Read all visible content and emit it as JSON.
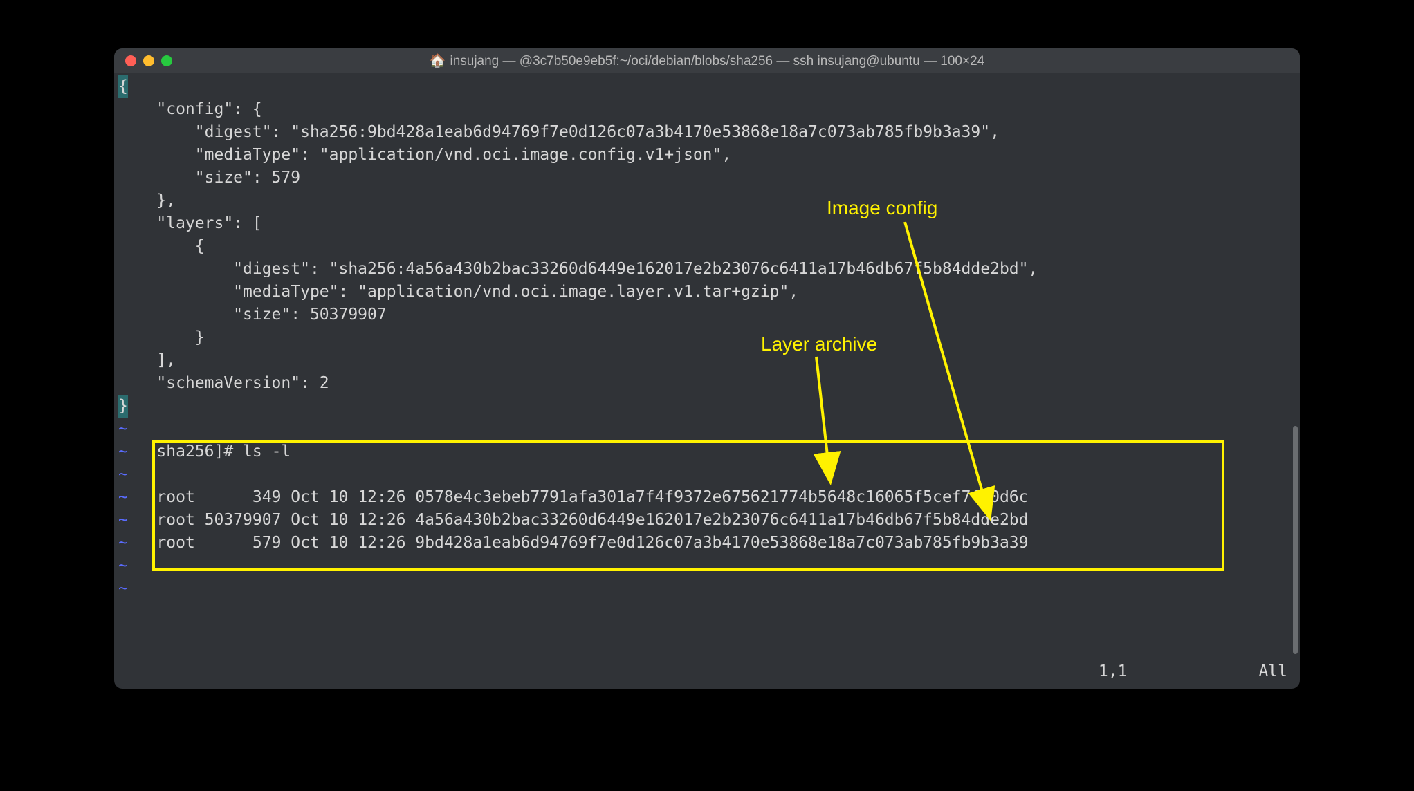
{
  "window": {
    "title": "insujang — @3c7b50e9eb5f:~/oci/debian/blobs/sha256 — ssh insujang@ubuntu — 100×24"
  },
  "json_output": {
    "open_brace": "{",
    "line_config": "    \"config\": {",
    "line_config_digest": "        \"digest\": \"sha256:9bd428a1eab6d94769f7e0d126c07a3b4170e53868e18a7c073ab785fb9b3a39\",",
    "line_config_media": "        \"mediaType\": \"application/vnd.oci.image.config.v1+json\",",
    "line_config_size": "        \"size\": 579",
    "line_config_close": "    },",
    "line_layers": "    \"layers\": [",
    "line_layers_open": "        {",
    "line_layer_digest": "            \"digest\": \"sha256:4a56a430b2bac33260d6449e162017e2b23076c6411a17b46db67f5b84dde2bd\",",
    "line_layer_media": "            \"mediaType\": \"application/vnd.oci.image.layer.v1.tar+gzip\",",
    "line_layer_size": "            \"size\": 50379907",
    "line_layers_close1": "        }",
    "line_layers_close2": "    ],",
    "line_schema": "    \"schemaVersion\": 2",
    "close_brace": "}"
  },
  "shell": {
    "prompt_line": " sha256]# ls -l",
    "ls_row1": " root      349 Oct 10 12:26 0578e4c3ebeb7791afa301a7f4f9372e675621774b5648c16065f5cef7fa0d6c",
    "ls_row2": " root 50379907 Oct 10 12:26 4a56a430b2bac33260d6449e162017e2b23076c6411a17b46db67f5b84dde2bd",
    "ls_row3": " root      579 Oct 10 12:26 9bd428a1eab6d94769f7e0d126c07a3b4170e53868e18a7c073ab785fb9b3a39"
  },
  "annotations": {
    "image_config": "Image config",
    "layer_archive": "Layer archive"
  },
  "status": {
    "pos": "1,1",
    "scroll": "All"
  },
  "tilde": "~"
}
